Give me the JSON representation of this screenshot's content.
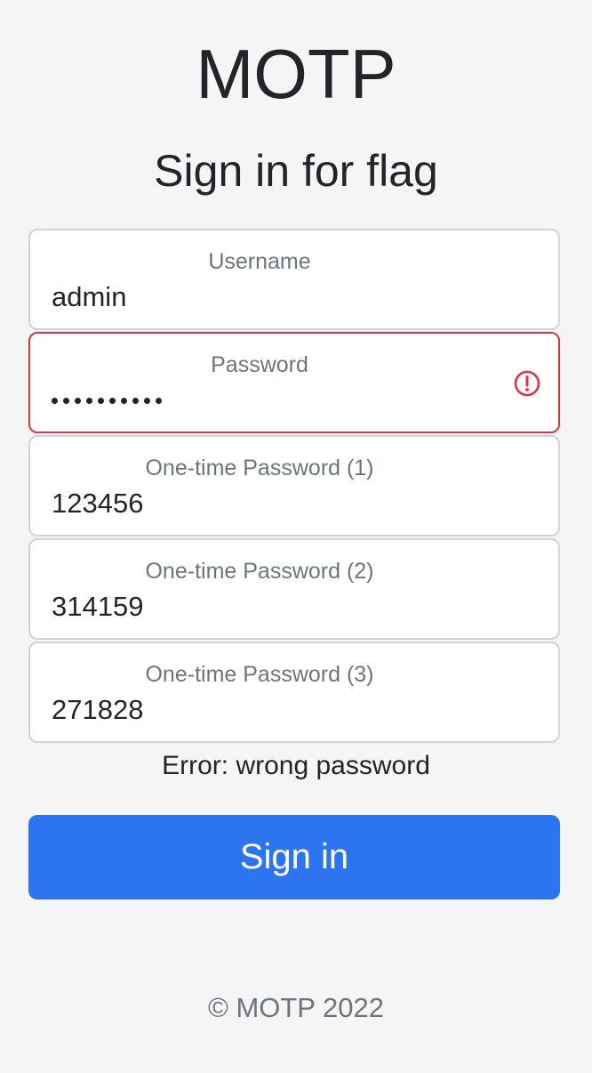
{
  "header": {
    "title": "MOTP",
    "subtitle": "Sign in for flag"
  },
  "form": {
    "username": {
      "label": "Username",
      "value": "admin"
    },
    "password": {
      "label": "Password",
      "masked_length": 10,
      "invalid_icon": "exclamation-circle-icon"
    },
    "otp1": {
      "label": "One-time Password (1)",
      "value": "123456"
    },
    "otp2": {
      "label": "One-time Password (2)",
      "value": "314159"
    },
    "otp3": {
      "label": "One-time Password (3)",
      "value": "271828"
    },
    "error_message": "Error: wrong password",
    "submit_label": "Sign in"
  },
  "footer": {
    "copyright": "© MOTP 2022"
  },
  "colors": {
    "primary": "#2d74f0",
    "danger": "#dc3545",
    "background": "#f5f5f5"
  }
}
